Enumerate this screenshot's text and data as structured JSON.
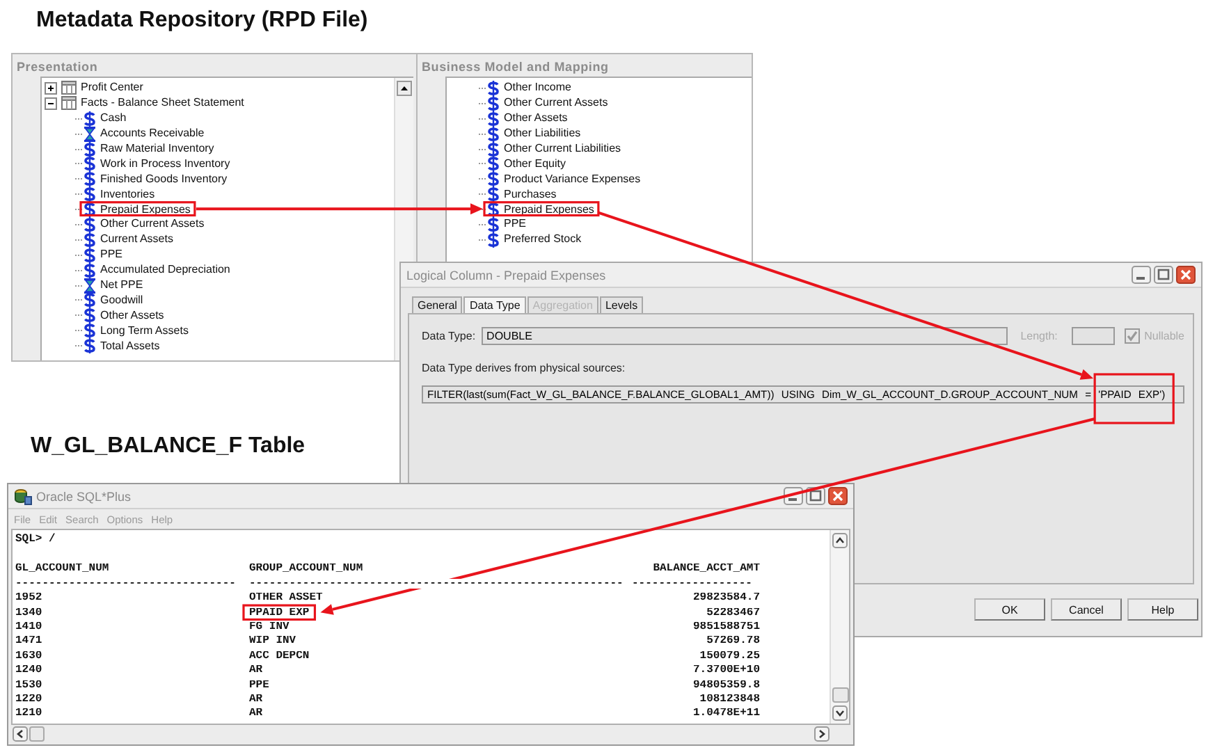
{
  "captions": [
    {
      "kind": "repository",
      "text": "Metadata Repository (RPD File)"
    },
    {
      "kind": "table",
      "text": "W_GL_BALANCE_F Table"
    }
  ],
  "presentation_panel": {
    "title": "Presentation",
    "items": [
      {
        "label": "Profit Center",
        "kind": "folder",
        "expanded": false
      },
      {
        "label": "Facts - Balance Sheet Statement",
        "kind": "folder",
        "expanded": true,
        "children": [
          {
            "label": "Cash",
            "kind": "measure"
          },
          {
            "label": "Accounts Receivable",
            "kind": "derived"
          },
          {
            "label": "Raw Material Inventory",
            "kind": "measure"
          },
          {
            "label": "Work in Process Inventory",
            "kind": "measure"
          },
          {
            "label": "Finished Goods Inventory",
            "kind": "measure"
          },
          {
            "label": "Inventories",
            "kind": "measure"
          },
          {
            "label": "Prepaid Expenses",
            "kind": "measure"
          },
          {
            "label": "Other Current Assets",
            "kind": "measure"
          },
          {
            "label": "Current Assets",
            "kind": "measure"
          },
          {
            "label": "PPE",
            "kind": "measure"
          },
          {
            "label": "Accumulated Depreciation",
            "kind": "measure"
          },
          {
            "label": "Net PPE",
            "kind": "derived"
          },
          {
            "label": "Goodwill",
            "kind": "measure"
          },
          {
            "label": "Other Assets",
            "kind": "measure"
          },
          {
            "label": "Long Term Assets",
            "kind": "measure"
          },
          {
            "label": "Total Assets",
            "kind": "measure"
          }
        ]
      }
    ]
  },
  "bmm_panel": {
    "title": "Business Model and Mapping",
    "items": [
      {
        "label": "Other Income",
        "kind": "measure"
      },
      {
        "label": "Other Current Assets",
        "kind": "measure"
      },
      {
        "label": "Other Assets",
        "kind": "measure"
      },
      {
        "label": "Other Liabilities",
        "kind": "measure"
      },
      {
        "label": "Other Current Liabilities",
        "kind": "measure"
      },
      {
        "label": "Other Equity",
        "kind": "measure"
      },
      {
        "label": "Product Variance Expenses",
        "kind": "measure"
      },
      {
        "label": "Purchases",
        "kind": "measure"
      },
      {
        "label": "Prepaid Expenses",
        "kind": "measure"
      },
      {
        "label": "PPE",
        "kind": "measure"
      },
      {
        "label": "Preferred Stock",
        "kind": "measure"
      }
    ]
  },
  "dialog": {
    "title": "Logical Column - Prepaid Expenses",
    "tabs": [
      {
        "label": "General",
        "selected": false,
        "disabled": false
      },
      {
        "label": "Data Type",
        "selected": true,
        "disabled": false
      },
      {
        "label": "Aggregation",
        "selected": false,
        "disabled": true
      },
      {
        "label": "Levels",
        "selected": false,
        "disabled": false
      }
    ],
    "data_type_label": "Data Type:",
    "data_type_value": "DOUBLE",
    "length_label": "Length:",
    "nullable": {
      "label": "Nullable",
      "checked": true,
      "disabled": true
    },
    "derives_label": "Data Type derives from physical sources:",
    "expression": "FILTER(last(sum(Fact_W_GL_BALANCE_F.BALANCE_GLOBAL1_AMT)) USING Dim_W_GL_ACCOUNT_D.GROUP_ACCOUNT_NUM = 'PPAID EXP')",
    "buttons": [
      "OK",
      "Cancel",
      "Help"
    ]
  },
  "sqlplus": {
    "title": "Oracle SQL*Plus",
    "menu": [
      "File",
      "Edit",
      "Search",
      "Options",
      "Help"
    ],
    "prompt": "SQL> /",
    "columns": [
      {
        "name": "GL_ACCOUNT_NUM",
        "underline": "---------------------------------"
      },
      {
        "name": "GROUP_ACCOUNT_NUM",
        "underline": "--------------------------------------------------------"
      },
      {
        "name": "BALANCE_ACCT_AMT",
        "underline": "------------------"
      }
    ],
    "rows": [
      [
        "1952",
        "OTHER ASSET",
        "29823584.7"
      ],
      [
        "1340",
        "PPAID EXP",
        "52283467"
      ],
      [
        "1410",
        "FG INV",
        "9851588751"
      ],
      [
        "1471",
        "WIP INV",
        "57269.78"
      ],
      [
        "1630",
        "ACC DEPCN",
        "150079.25"
      ],
      [
        "1240",
        "AR",
        "7.3700E+10"
      ],
      [
        "1530",
        "PPE",
        "94805359.8"
      ],
      [
        "1220",
        "AR",
        "108123848"
      ],
      [
        "1210",
        "AR",
        "1.0478E+11"
      ]
    ]
  }
}
